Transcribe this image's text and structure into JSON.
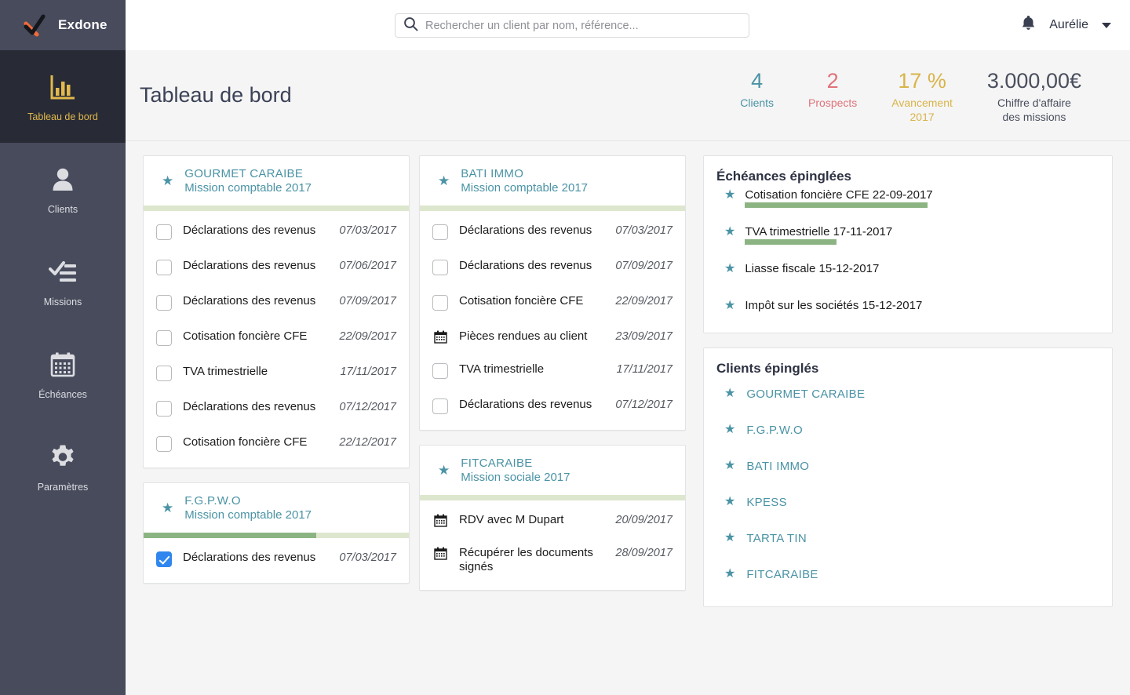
{
  "brand": {
    "name": "Exdone",
    "logo_icon": "check-logo-icon"
  },
  "sidebar": {
    "items": [
      {
        "label": "Tableau de bord",
        "icon": "bar-chart-icon",
        "active": true
      },
      {
        "label": "Clients",
        "icon": "user-icon",
        "active": false
      },
      {
        "label": "Missions",
        "icon": "checklist-icon",
        "active": false
      },
      {
        "label": "Échéances",
        "icon": "calendar-icon",
        "active": false
      },
      {
        "label": "Paramètres",
        "icon": "gear-icon",
        "active": false
      }
    ]
  },
  "topbar": {
    "search_placeholder": "Rechercher un client par nom, référence...",
    "search_value": "",
    "search_icon": "search-icon",
    "bell_icon": "bell-icon",
    "user_name": "Aurélie",
    "caret_icon": "chevron-down-icon"
  },
  "page": {
    "title": "Tableau de bord"
  },
  "stats": [
    {
      "value": "4",
      "label": "Clients",
      "color": "#4a93a5"
    },
    {
      "value": "2",
      "label": "Prospects",
      "color": "#e0737b"
    },
    {
      "value": "17 %",
      "label": "Avancement 2017",
      "label_line1": "Avancement",
      "label_line2": "2017",
      "color": "#d9b44a"
    },
    {
      "value": "3.000,00€",
      "label": "Chiffre d'affaire des missions",
      "label_line1": "Chiffre d'affaire",
      "label_line2": "des missions",
      "color": "#4a4f5e"
    }
  ],
  "colors": {
    "teal": "#4a93a5",
    "green_fill": "#8cb483",
    "green_track": "#dde7cd",
    "sidebar": "#474b5c",
    "sidebar_active": "#282b36",
    "accent_yellow": "#e3b94c",
    "checkbox_blue": "#2f86ee",
    "logo_orange": "#f26b38"
  },
  "columns": [
    {
      "cards": [
        {
          "client": "GOURMET CARAIBE",
          "mission": "Mission comptable 2017",
          "progress": 0,
          "star_icon": "star-icon",
          "tasks": [
            {
              "name": "Déclarations des revenus",
              "date": "07/03/2017",
              "type": "checkbox",
              "checked": false
            },
            {
              "name": "Déclarations des revenus",
              "date": "07/06/2017",
              "type": "checkbox",
              "checked": false
            },
            {
              "name": "Déclarations des revenus",
              "date": "07/09/2017",
              "type": "checkbox",
              "checked": false
            },
            {
              "name": "Cotisation foncière CFE",
              "date": "22/09/2017",
              "type": "checkbox",
              "checked": false
            },
            {
              "name": "TVA trimestrielle",
              "date": "17/11/2017",
              "type": "checkbox",
              "checked": false
            },
            {
              "name": "Déclarations des revenus",
              "date": "07/12/2017",
              "type": "checkbox",
              "checked": false
            },
            {
              "name": "Cotisation foncière CFE",
              "date": "22/12/2017",
              "type": "checkbox",
              "checked": false
            }
          ]
        },
        {
          "client": "F.G.P.W.O",
          "mission": "Mission comptable 2017",
          "progress": 65,
          "star_icon": "star-icon",
          "tasks": [
            {
              "name": "Déclarations des revenus",
              "date": "07/03/2017",
              "type": "checkbox",
              "checked": true
            }
          ]
        }
      ]
    },
    {
      "cards": [
        {
          "client": "BATI IMMO",
          "mission": "Mission comptable 2017",
          "progress": 0,
          "star_icon": "star-icon",
          "tasks": [
            {
              "name": "Déclarations des revenus",
              "date": "07/03/2017",
              "type": "checkbox",
              "checked": false
            },
            {
              "name": "Déclarations des revenus",
              "date": "07/09/2017",
              "type": "checkbox",
              "checked": false
            },
            {
              "name": "Cotisation foncière CFE",
              "date": "22/09/2017",
              "type": "checkbox",
              "checked": false
            },
            {
              "name": "Pièces rendues au client",
              "date": "23/09/2017",
              "type": "calendar",
              "checked": false
            },
            {
              "name": "TVA trimestrielle",
              "date": "17/11/2017",
              "type": "checkbox",
              "checked": false
            },
            {
              "name": "Déclarations des revenus",
              "date": "07/12/2017",
              "type": "checkbox",
              "checked": false
            }
          ]
        },
        {
          "client": "FITCARAIBE",
          "mission": "Mission sociale 2017",
          "progress": 0,
          "star_icon": "star-icon",
          "tasks": [
            {
              "name": "RDV avec M Dupart",
              "date": "20/09/2017",
              "type": "calendar",
              "checked": false
            },
            {
              "name": "Récupérer les documents signés",
              "date": "28/09/2017",
              "type": "calendar",
              "checked": false
            }
          ]
        }
      ]
    }
  ],
  "pinned_deadlines": {
    "title": "Échéances épinglées",
    "items": [
      {
        "text": "Cotisation foncière CFE 22-09-2017",
        "progress": 52,
        "star_icon": "star-icon"
      },
      {
        "text": "TVA trimestrielle 17-11-2017",
        "progress": 26,
        "star_icon": "star-icon"
      },
      {
        "text": "Liasse fiscale 15-12-2017",
        "progress": 0,
        "star_icon": "star-icon"
      },
      {
        "text": "Impôt sur les sociétés 15-12-2017",
        "progress": 0,
        "star_icon": "star-icon"
      }
    ]
  },
  "pinned_clients": {
    "title": "Clients épinglés",
    "items": [
      {
        "name": "GOURMET CARAIBE",
        "star_icon": "star-icon"
      },
      {
        "name": "F.G.P.W.O",
        "star_icon": "star-icon"
      },
      {
        "name": "BATI IMMO",
        "star_icon": "star-icon"
      },
      {
        "name": "KPESS",
        "star_icon": "star-icon"
      },
      {
        "name": "TARTA TIN",
        "star_icon": "star-icon"
      },
      {
        "name": "FITCARAIBE",
        "star_icon": "star-icon"
      }
    ]
  }
}
